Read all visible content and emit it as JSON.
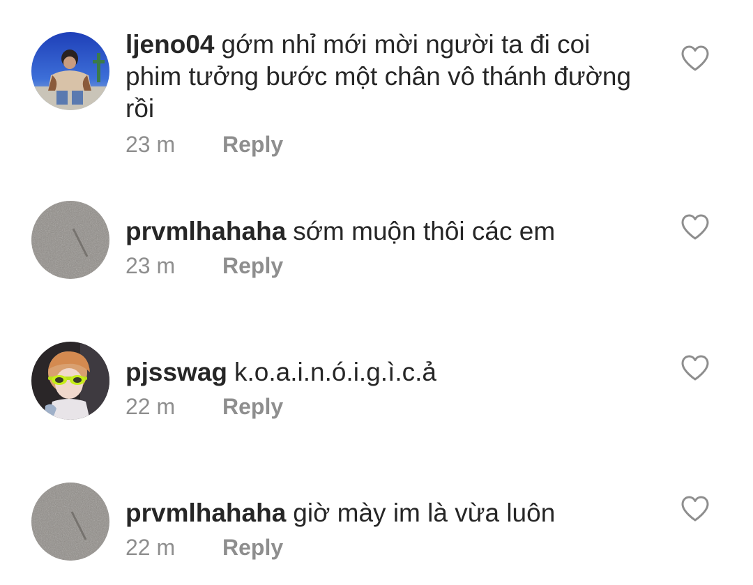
{
  "comments": [
    {
      "username": "ljeno04",
      "text": "gớm nhỉ mới mời người ta đi coi phim tưởng bước một chân vô thánh đường rồi",
      "time": "23 m",
      "reply_label": "Reply",
      "avatar": "avatar-photo-person-blue-sky",
      "like_icon": "heart-outline-icon"
    },
    {
      "username": "prvmlhahaha",
      "text": "sớm muộn thôi các em",
      "time": "23 m",
      "reply_label": "Reply",
      "avatar": "avatar-grey-texture",
      "like_icon": "heart-outline-icon"
    },
    {
      "username": "pjsswag",
      "text": "k.o.a.i.n.ó.i.g.ì.c.ả",
      "time": "22 m",
      "reply_label": "Reply",
      "avatar": "avatar-photo-person-green-sunglasses",
      "like_icon": "heart-outline-icon"
    },
    {
      "username": "prvmlhahaha",
      "text": "giờ mày im là vừa luôn",
      "time": "22 m",
      "reply_label": "Reply",
      "avatar": "avatar-grey-texture",
      "like_icon": "heart-outline-icon"
    }
  ],
  "colors": {
    "text": "#262626",
    "muted": "#8e8e8e",
    "background": "#ffffff"
  }
}
